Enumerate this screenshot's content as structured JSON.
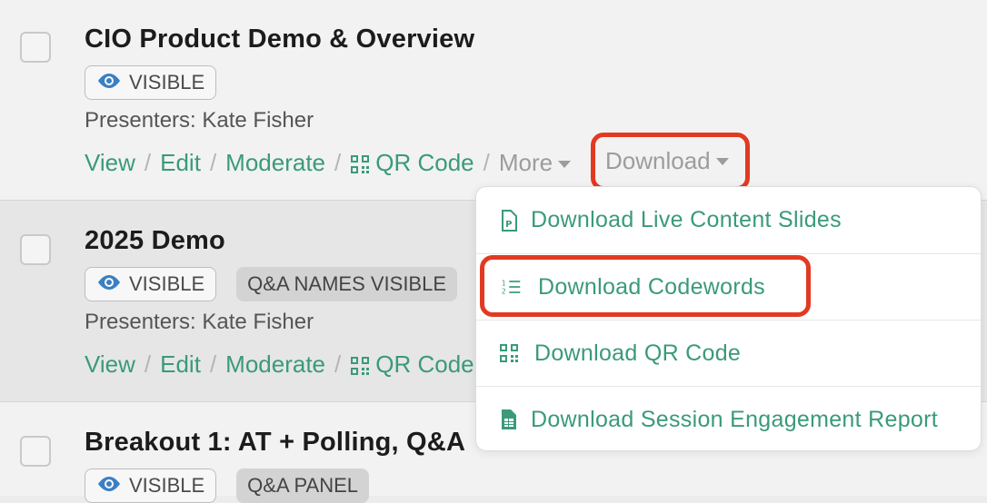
{
  "sessions": [
    {
      "title": "CIO Product Demo & Overview",
      "badges": [
        "VISIBLE"
      ],
      "presenters": "Presenters: Kate Fisher",
      "actions": {
        "view": "View",
        "edit": "Edit",
        "moderate": "Moderate",
        "qr_code": "QR Code",
        "more": "More",
        "download": "Download"
      }
    },
    {
      "title": "2025 Demo",
      "badges": [
        "VISIBLE",
        "Q&A NAMES VISIBLE"
      ],
      "presenters": "Presenters: Kate Fisher",
      "actions": {
        "view": "View",
        "edit": "Edit",
        "moderate": "Moderate",
        "qr_code": "QR Code"
      }
    },
    {
      "title": "Breakout 1: AT + Polling, Q&A",
      "badges": [
        "VISIBLE",
        "Q&A PANEL"
      ]
    }
  ],
  "separator": "/",
  "download_menu": {
    "items": [
      {
        "label": "Download Live Content Slides",
        "icon": "pdf-file-icon"
      },
      {
        "label": "Download Codewords",
        "icon": "numbered-list-icon"
      },
      {
        "label": "Download QR Code",
        "icon": "qr-code-icon"
      },
      {
        "label": "Download Session Engagement Report",
        "icon": "spreadsheet-file-icon"
      }
    ]
  },
  "colors": {
    "link": "#3a9a7a",
    "highlight": "#e23a22",
    "muted": "#9c9c9c"
  }
}
